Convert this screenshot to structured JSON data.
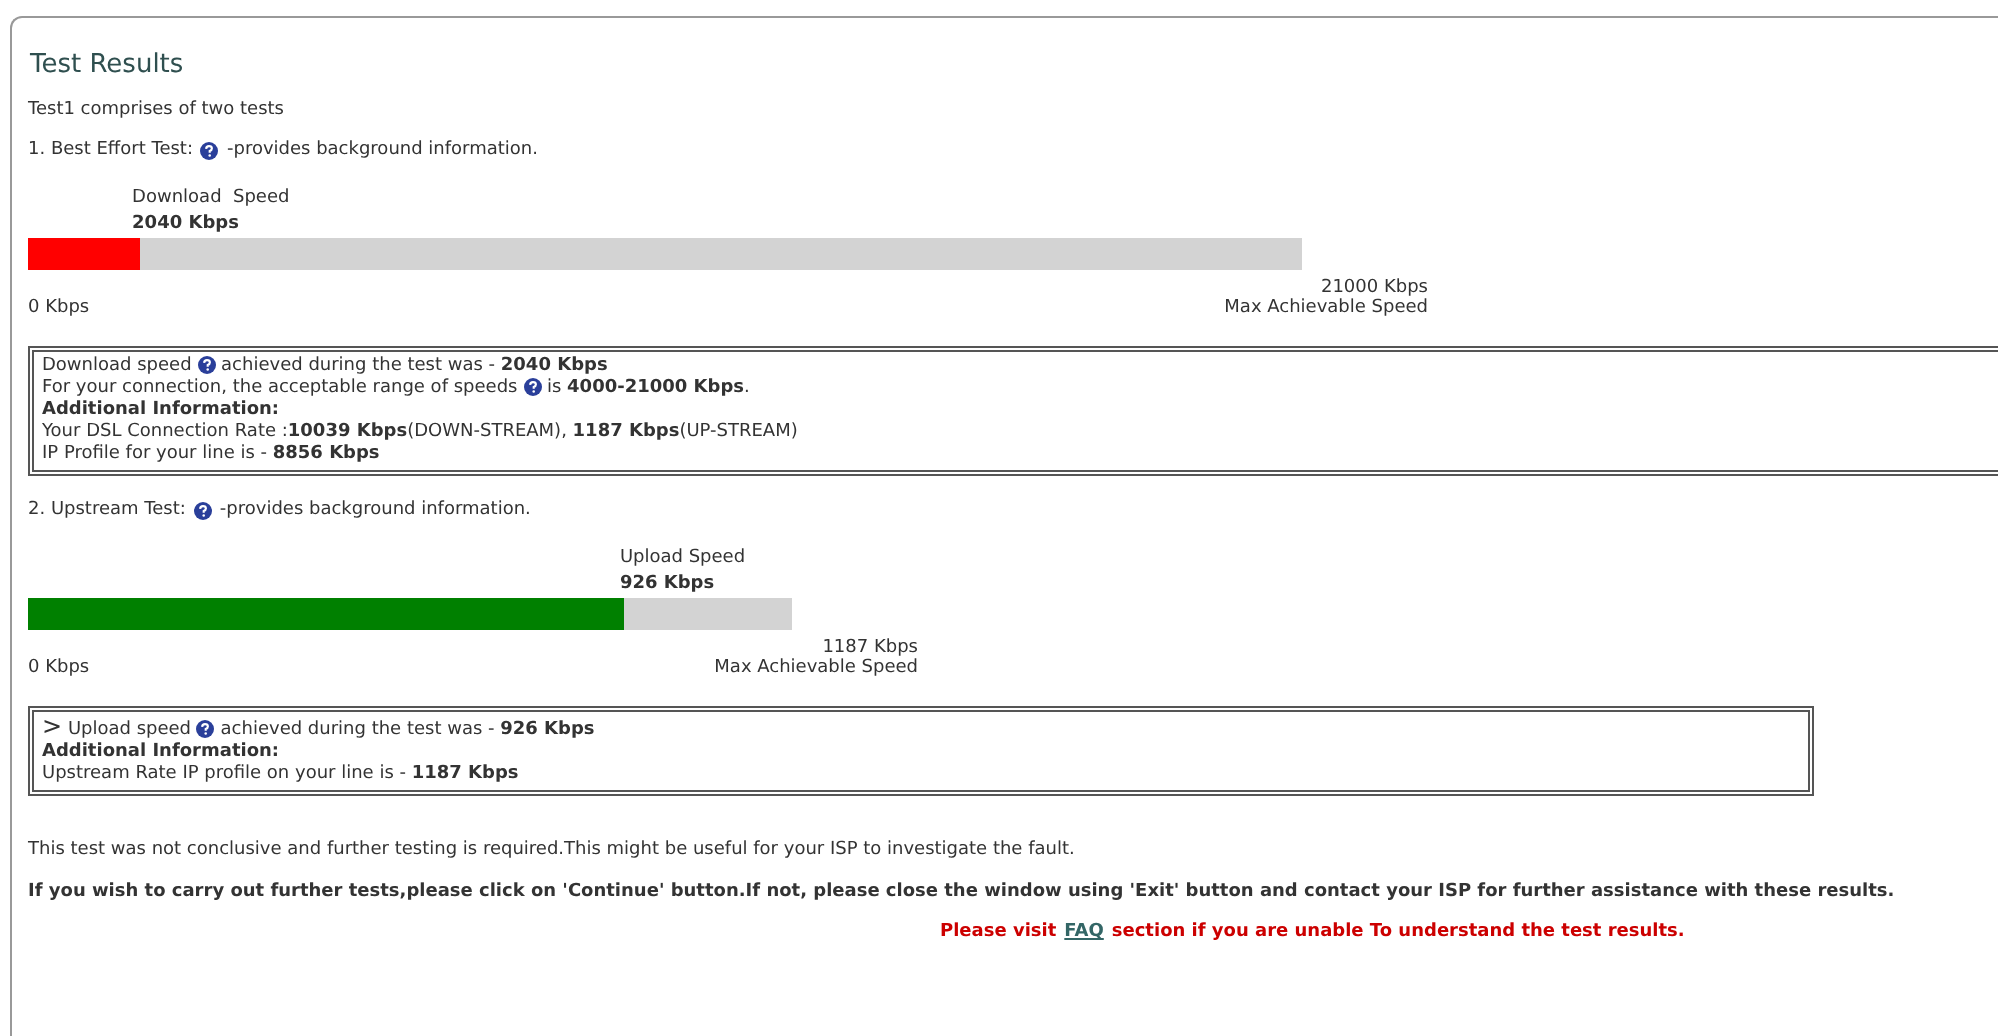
{
  "title": "Test Results",
  "intro": "Test1 comprises of two tests",
  "tests": [
    {
      "heading": [
        {
          "kind": "text",
          "text": "1. Best Effort Test:"
        },
        {
          "kind": "help"
        },
        {
          "kind": "text",
          "text": "-provides background information."
        }
      ],
      "meter": {
        "label": "Download  Speed",
        "reading": "2040 Kbps",
        "level": 0.088,
        "color": "#ff0000",
        "min": "0 Kbps",
        "max": "21000 Kbps",
        "max_caption": "Max Achievable Speed"
      },
      "info": [
        [
          {
            "kind": "text",
            "text": "Download speed"
          },
          {
            "kind": "help"
          },
          {
            "kind": "text",
            "text": "achieved during the test was - **2040 Kbps**"
          }
        ],
        [
          {
            "kind": "text",
            "text": "For your connection, the acceptable range of speeds"
          },
          {
            "kind": "help"
          },
          {
            "kind": "text",
            "text": "is **4000-21000 Kbps**."
          }
        ],
        [
          {
            "kind": "bold",
            "text": "Additional Information:"
          }
        ],
        [
          {
            "kind": "text",
            "text": "Your DSL Connection Rate :**10039 Kbps**(DOWN-STREAM), **1187 Kbps**(UP-STREAM)"
          }
        ],
        [
          {
            "kind": "text",
            "text": "IP Profile for your line is - **8856 Kbps**"
          }
        ]
      ]
    },
    {
      "heading": [
        {
          "kind": "text",
          "text": "2. Upstream Test:"
        },
        {
          "kind": "help"
        },
        {
          "kind": "text",
          "text": "-provides background information."
        }
      ],
      "meter": {
        "label": "Upload Speed",
        "reading": "926 Kbps",
        "level": 0.78,
        "color": "#008000",
        "min": "0 Kbps",
        "max": "1187 Kbps",
        "max_caption": "Max Achievable Speed"
      },
      "info": [
        [
          {
            "kind": "mark",
            "text": ">"
          },
          {
            "kind": "text",
            "text": "Upload speed"
          },
          {
            "kind": "help"
          },
          {
            "kind": "text",
            "text": "achieved during the test was - **926 Kbps**"
          }
        ],
        [
          {
            "kind": "bold",
            "text": "Additional Information:"
          }
        ],
        [
          {
            "kind": "text",
            "text": "Upstream Rate IP profile on your line is - **1187 Kbps**"
          }
        ]
      ]
    }
  ],
  "note": "This test was not conclusive and further testing is required.This might be useful for your ISP to investigate the fault.",
  "instruction": "If you wish to carry out further tests,please click on 'Continue' button.If not, please close the window using 'Exit' button and contact your ISP for further assistance with these results.",
  "faq_line": {
    "before": "Please visit",
    "link": "FAQ",
    "after": "section if you are unable To understand the test results."
  }
}
